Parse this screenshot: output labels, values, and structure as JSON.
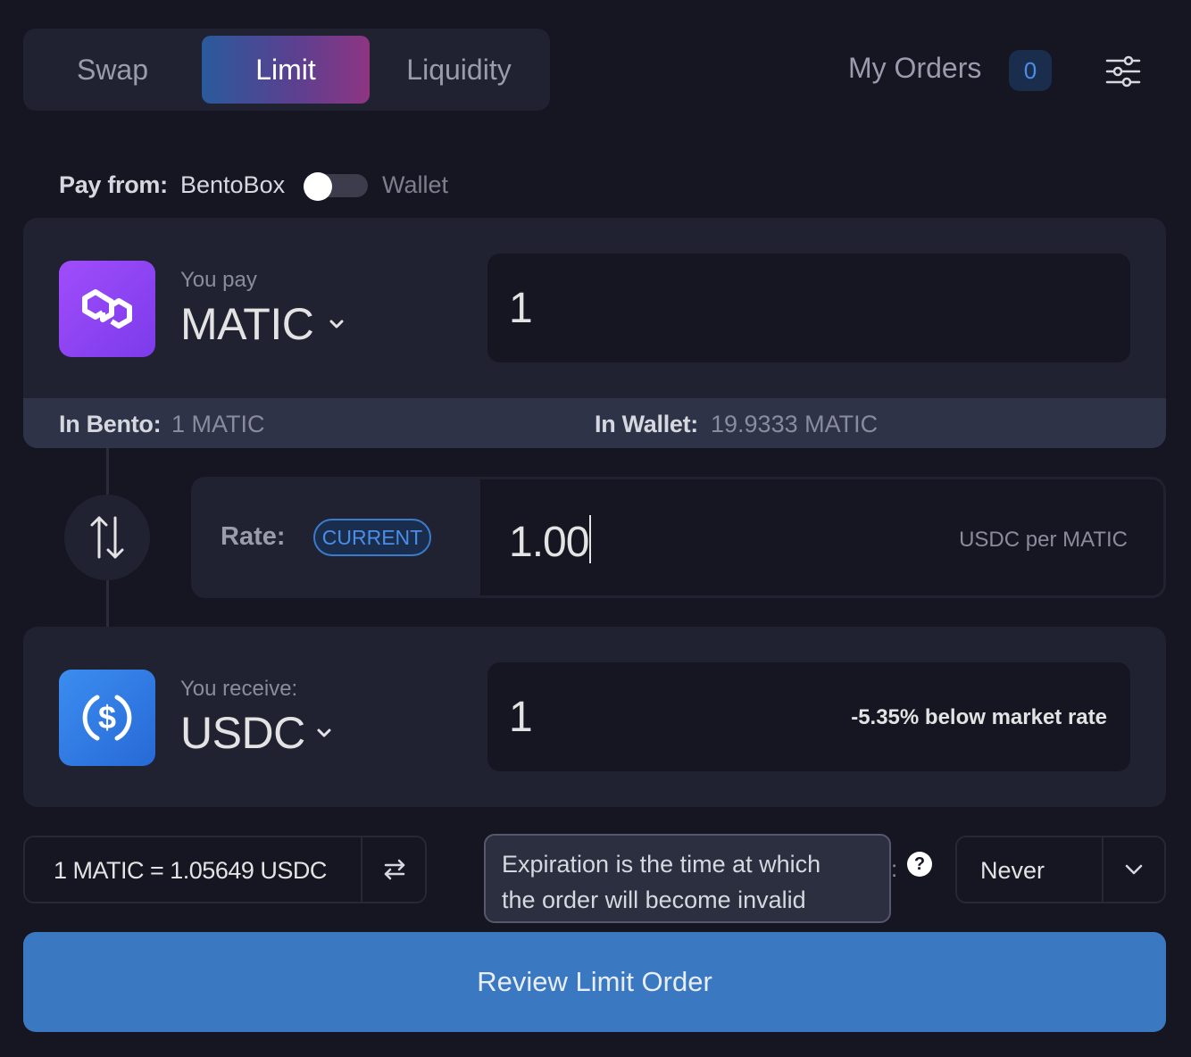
{
  "tabs": [
    {
      "label": "Swap"
    },
    {
      "label": "Limit"
    },
    {
      "label": "Liquidity"
    }
  ],
  "header": {
    "my_orders_label": "My Orders",
    "orders_count": "0"
  },
  "pay_from": {
    "label": "Pay from:",
    "option_left": "BentoBox",
    "option_right": "Wallet"
  },
  "pay": {
    "sub_label": "You pay",
    "token": "MATIC",
    "amount": "1",
    "in_bento_label": "In Bento:",
    "in_bento_value": "1 MATIC",
    "in_wallet_label": "In Wallet:",
    "in_wallet_value": "19.9333 MATIC"
  },
  "rate": {
    "label": "Rate:",
    "current_button": "CURRENT",
    "value": "1.00",
    "unit": "USDC per MATIC"
  },
  "receive": {
    "sub_label": "You receive:",
    "token": "USDC",
    "amount": "1",
    "market_note": "-5.35% below market rate"
  },
  "price": {
    "text": "1 MATIC = 1.05649 USDC"
  },
  "expiration": {
    "tooltip_line1": "Expiration is the time at which",
    "tooltip_line2": "the order will become invalid",
    "colon": ":",
    "help_glyph": "?",
    "value": "Never"
  },
  "review_button": "Review Limit Order",
  "colors": {
    "background": "#161522",
    "panel": "#202231",
    "accent_blue": "#3a78c1",
    "matic_purple": "#8a43f5",
    "usdc_blue": "#2f7be3"
  },
  "icons": [
    "settings-sliders-icon",
    "matic-logo-icon",
    "usdc-logo-icon",
    "chevron-down-icon",
    "swap-arrows-icon",
    "swap-horizontal-icon",
    "help-icon"
  ]
}
